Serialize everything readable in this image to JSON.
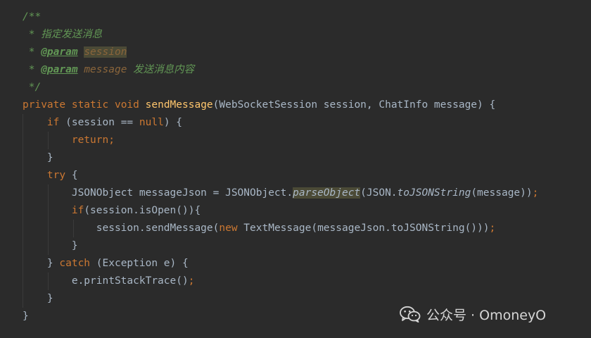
{
  "code": {
    "doc_open": "/**",
    "doc_star": " * ",
    "doc_desc": "指定发送消息",
    "doc_param_tag": "@param",
    "doc_param1": "session",
    "doc_param2": "message",
    "doc_param2_desc": " 发送消息内容",
    "doc_close": " */",
    "kw_private": "private",
    "kw_static": "static",
    "kw_void": "void",
    "method_name": "sendMessage",
    "sig_params": "(WebSocketSession session, ChatInfo message) {",
    "kw_if": "if",
    "if_cond": " (session == ",
    "kw_null": "null",
    "if_close": ") {",
    "kw_return": "return",
    "semi": ";",
    "close_brace": "}",
    "kw_try": "try",
    "open_brace": " {",
    "json_decl": "JSONObject messageJson = JSONObject.",
    "parse_object": "parseObject",
    "json_mid": "(JSON.",
    "to_json_string": "toJSONString",
    "json_end": "(message))",
    "if2_open": "(session.isOpen()){",
    "send_call": "session.sendMessage(",
    "kw_new": "new",
    "send_rest": " TextMessage(messageJson.toJSONString()))",
    "catch_prefix": "} ",
    "kw_catch": "catch",
    "catch_rest": " (Exception e) {",
    "print_trace": "e.printStackTrace()"
  },
  "watermark": {
    "icon": "wechat-icon",
    "text": "公众号 · OmoneyO"
  }
}
